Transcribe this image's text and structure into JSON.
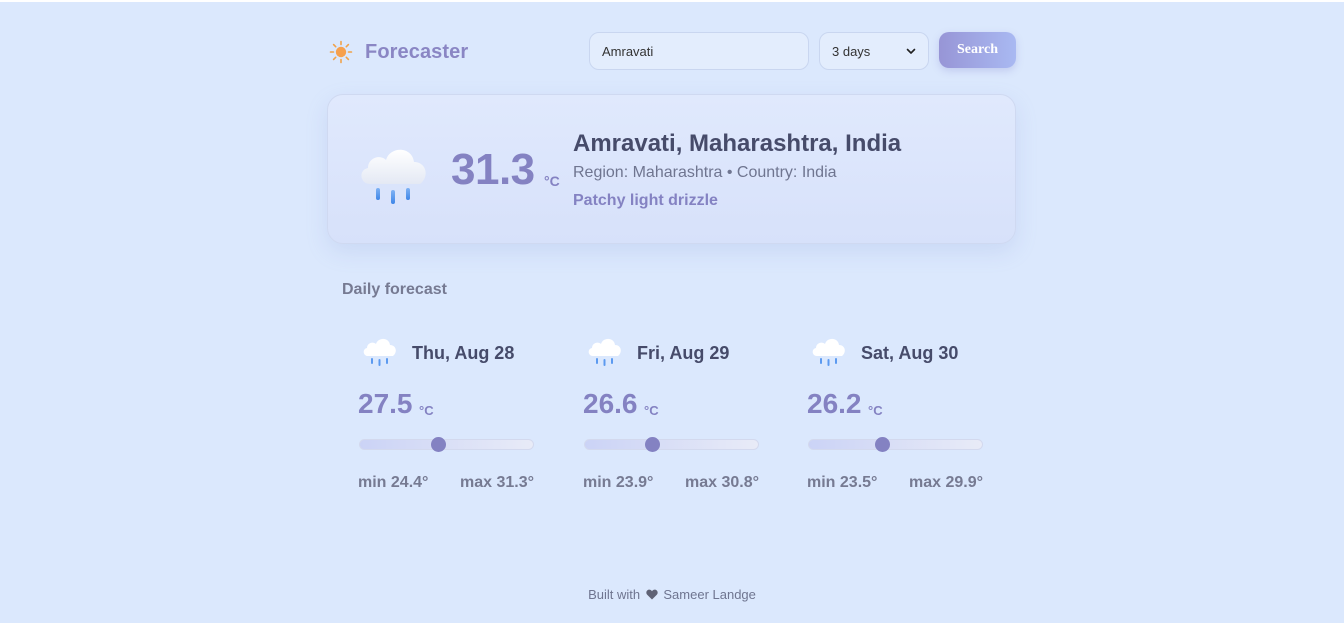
{
  "header": {
    "brand_name": "Forecaster",
    "brand_icon": "sun-icon",
    "search_value": "Amravati",
    "days_selected": "3 days",
    "search_label": "Search"
  },
  "current": {
    "icon": "rain-cloud-icon",
    "temp": "31.3",
    "unit": "°C",
    "location": "Amravati, Maharashtra, India",
    "region_line": "Region: Maharashtra • Country: India",
    "condition": "Patchy light drizzle"
  },
  "daily": {
    "title": "Daily forecast",
    "days": [
      {
        "date": "Thu, Aug 28",
        "temp": "27.5",
        "unit": "°C",
        "min": "min 24.4°",
        "max": "max 31.3°",
        "level": 0.45
      },
      {
        "date": "Fri, Aug 29",
        "temp": "26.6",
        "unit": "°C",
        "min": "min 23.9°",
        "max": "max 30.8°",
        "level": 0.39
      },
      {
        "date": "Sat, Aug 30",
        "temp": "26.2",
        "unit": "°C",
        "min": "min 23.5°",
        "max": "max 29.9°",
        "level": 0.42
      }
    ]
  },
  "footer": {
    "prefix": "Built with",
    "author": "Sameer Landge"
  },
  "colors": {
    "background": "#dbe8fd",
    "accent": "#8482c2",
    "button_gradient_start": "#9795d6",
    "button_gradient_end": "#a9b9f2"
  }
}
